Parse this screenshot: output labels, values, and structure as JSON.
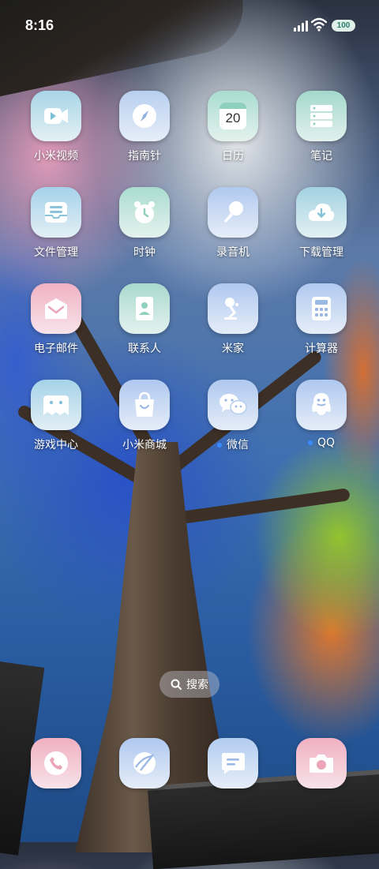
{
  "status": {
    "time": "8:16",
    "battery": "100"
  },
  "apps": [
    {
      "label": "小米视频",
      "icon": "video-camera-icon",
      "bg": "#a8d5e8"
    },
    {
      "label": "指南针",
      "icon": "compass-icon",
      "bg": "#bcd2ee"
    },
    {
      "label": "日历",
      "icon": "calendar-icon",
      "bg": "#b6e0d6",
      "date": "20"
    },
    {
      "label": "笔记",
      "icon": "notes-server-icon",
      "bg": "#a9dccf"
    },
    {
      "label": "文件管理",
      "icon": "file-box-icon",
      "bg": "#a8d4ea"
    },
    {
      "label": "时钟",
      "icon": "alarm-clock-icon",
      "bg": "#b4e0d5"
    },
    {
      "label": "录音机",
      "icon": "microphone-icon",
      "bg": "#b5cdf0"
    },
    {
      "label": "下载管理",
      "icon": "download-cloud-icon",
      "bg": "#a8d5e3"
    },
    {
      "label": "电子邮件",
      "icon": "email-icon",
      "bg": "#f2b8c8"
    },
    {
      "label": "联系人",
      "icon": "contact-book-icon",
      "bg": "#b0ddd3"
    },
    {
      "label": "米家",
      "icon": "desk-lamp-icon",
      "bg": "#b6cdef"
    },
    {
      "label": "计算器",
      "icon": "calculator-icon",
      "bg": "#b4cdee"
    },
    {
      "label": "游戏中心",
      "icon": "game-ghost-icon",
      "bg": "#a9d6e8"
    },
    {
      "label": "小米商城",
      "icon": "shopping-bag-icon",
      "bg": "#b3cdee"
    },
    {
      "label": "微信",
      "icon": "wechat-icon",
      "bg": "#b4ccef",
      "new": true
    },
    {
      "label": "QQ",
      "icon": "qq-penguin-icon",
      "bg": "#b3cdee",
      "new": true
    }
  ],
  "search": {
    "label": "搜索"
  },
  "dock": [
    {
      "icon": "phone-icon",
      "bg": "#f2b7c6"
    },
    {
      "icon": "browser-icon",
      "bg": "#b5cdee"
    },
    {
      "icon": "message-icon",
      "bg": "#b8d2ef"
    },
    {
      "icon": "camera-icon",
      "bg": "#f2b7c6"
    }
  ]
}
